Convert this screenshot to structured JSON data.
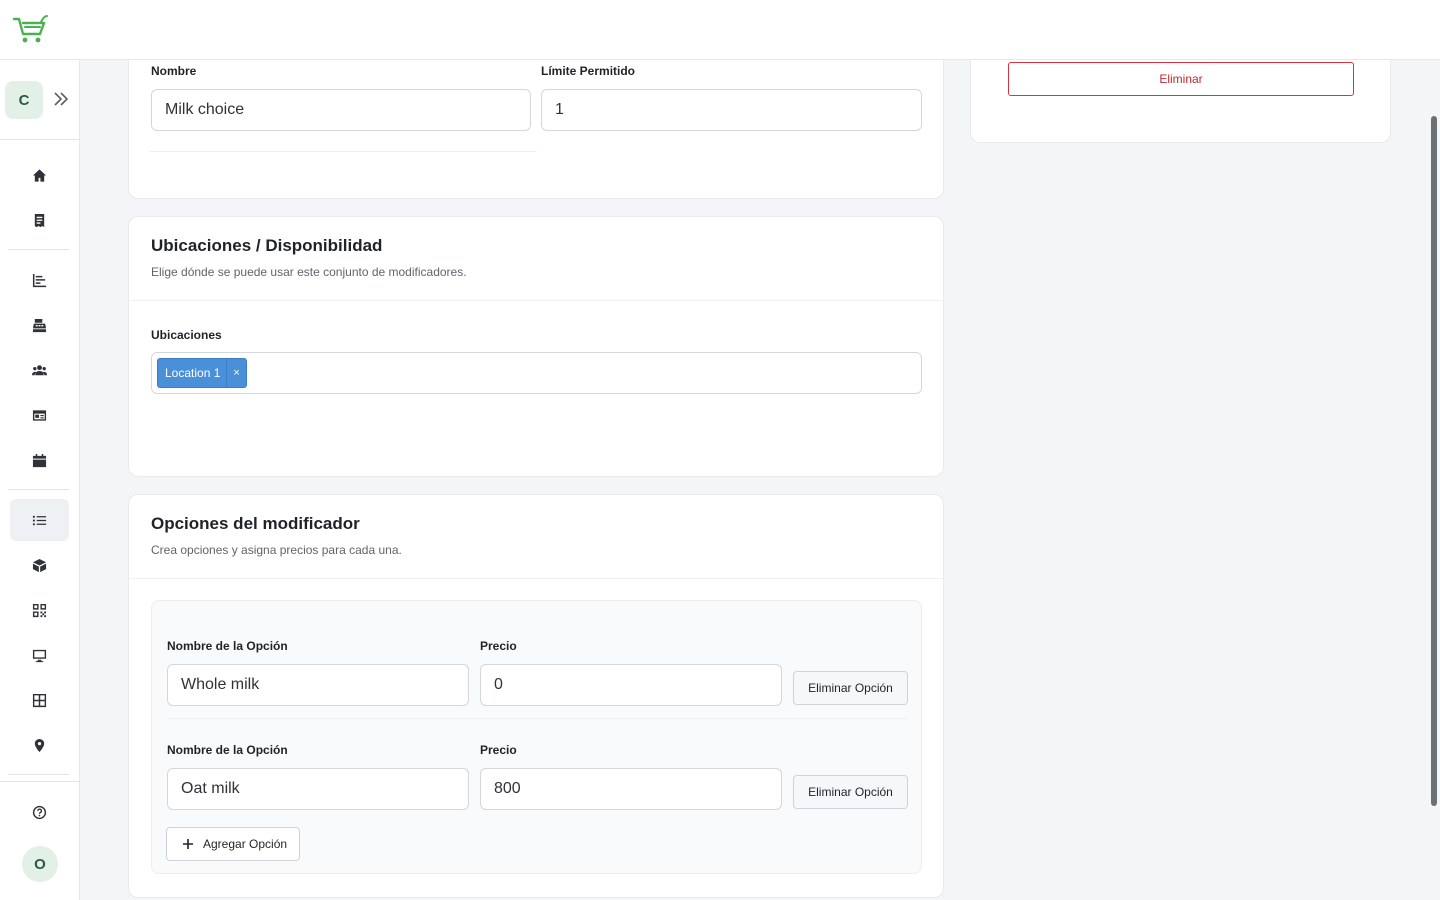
{
  "sidebar": {
    "workspace_initial": "C",
    "user_initial": "O"
  },
  "general": {
    "name_label": "Nombre",
    "name_value": "Milk choice",
    "limit_label": "Límite Permitido",
    "limit_value": "1"
  },
  "locations": {
    "title": "Ubicaciones / Disponibilidad",
    "subtitle": "Elige dónde se puede usar este conjunto de modificadores.",
    "field_label": "Ubicaciones",
    "tags": [
      "Location 1"
    ],
    "tag_remove": "×"
  },
  "options": {
    "title": "Opciones del modificador",
    "subtitle": "Crea opciones y asigna precios para cada una.",
    "items": [
      {
        "name_label": "Nombre de la Opción",
        "name_value": "Whole milk",
        "price_label": "Precio",
        "price_value": "0",
        "remove_label": "Eliminar Opción"
      },
      {
        "name_label": "Nombre de la Opción",
        "name_value": "Oat milk",
        "price_label": "Precio",
        "price_value": "800",
        "remove_label": "Eliminar Opción"
      }
    ],
    "add_label": "Agregar Opción"
  },
  "actions": {
    "delete_label": "Eliminar"
  },
  "colors": {
    "brand_green": "#4caf50",
    "tag_blue": "#4a90d9",
    "danger": "#d9333f"
  },
  "icons": [
    "cart-logo-icon",
    "chevrons-right-icon",
    "home-icon",
    "receipt-icon",
    "chart-icon",
    "register-icon",
    "users-icon",
    "id-card-icon",
    "calendar-icon",
    "list-icon",
    "box-icon",
    "qr-icon",
    "monitor-icon",
    "grid-icon",
    "map-pin-icon",
    "help-icon",
    "plus-icon"
  ]
}
